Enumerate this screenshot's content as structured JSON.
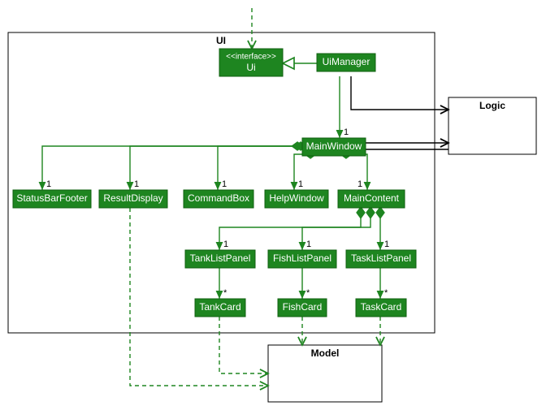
{
  "packages": {
    "ui": {
      "label": "UI"
    },
    "logic": {
      "label": "Logic"
    },
    "model": {
      "label": "Model"
    }
  },
  "nodes": {
    "ui_if": {
      "stereo": "<<interface>>",
      "name": "Ui"
    },
    "uimanager": {
      "name": "UiManager"
    },
    "mainwindow": {
      "name": "MainWindow"
    },
    "statusbar": {
      "name": "StatusBarFooter"
    },
    "resultdisp": {
      "name": "ResultDisplay"
    },
    "commandbox": {
      "name": "CommandBox"
    },
    "helpwindow": {
      "name": "HelpWindow"
    },
    "maincontent": {
      "name": "MainContent"
    },
    "tanklist": {
      "name": "TankListPanel"
    },
    "fishlist": {
      "name": "FishListPanel"
    },
    "tasklist": {
      "name": "TaskListPanel"
    },
    "tankcard": {
      "name": "TankCard"
    },
    "fishcard": {
      "name": "FishCard"
    },
    "taskcard": {
      "name": "TaskCard"
    }
  },
  "mult": {
    "one": "1",
    "star": "*"
  },
  "chart_data": {
    "type": "uml-class-diagram",
    "packages": [
      {
        "name": "UI",
        "contains": [
          "Ui",
          "UiManager",
          "MainWindow",
          "StatusBarFooter",
          "ResultDisplay",
          "CommandBox",
          "HelpWindow",
          "MainContent",
          "TankListPanel",
          "FishListPanel",
          "TaskListPanel",
          "TankCard",
          "FishCard",
          "TaskCard"
        ]
      },
      {
        "name": "Logic",
        "contains": []
      },
      {
        "name": "Model",
        "contains": []
      }
    ],
    "interfaces": [
      "Ui"
    ],
    "relationships": [
      {
        "from": "external",
        "to": "Ui",
        "kind": "dependency"
      },
      {
        "from": "UiManager",
        "to": "Ui",
        "kind": "realization"
      },
      {
        "from": "UiManager",
        "to": "MainWindow",
        "kind": "association",
        "mult_to": "1"
      },
      {
        "from": "MainWindow",
        "to": "StatusBarFooter",
        "kind": "composition",
        "mult_to": "1"
      },
      {
        "from": "MainWindow",
        "to": "ResultDisplay",
        "kind": "composition",
        "mult_to": "1"
      },
      {
        "from": "MainWindow",
        "to": "CommandBox",
        "kind": "composition",
        "mult_to": "1"
      },
      {
        "from": "MainWindow",
        "to": "HelpWindow",
        "kind": "composition",
        "mult_to": "1"
      },
      {
        "from": "MainWindow",
        "to": "MainContent",
        "kind": "composition",
        "mult_to": "1"
      },
      {
        "from": "MainContent",
        "to": "TankListPanel",
        "kind": "composition",
        "mult_to": "1"
      },
      {
        "from": "MainContent",
        "to": "FishListPanel",
        "kind": "composition",
        "mult_to": "1"
      },
      {
        "from": "MainContent",
        "to": "TaskListPanel",
        "kind": "composition",
        "mult_to": "1"
      },
      {
        "from": "TankListPanel",
        "to": "TankCard",
        "kind": "association",
        "mult_to": "*"
      },
      {
        "from": "FishListPanel",
        "to": "FishCard",
        "kind": "association",
        "mult_to": "*"
      },
      {
        "from": "TaskListPanel",
        "to": "TaskCard",
        "kind": "association",
        "mult_to": "*"
      },
      {
        "from": "UiManager",
        "to": "Logic",
        "kind": "association"
      },
      {
        "from": "MainWindow",
        "to": "Logic",
        "kind": "association"
      },
      {
        "from": "TankCard",
        "to": "Model",
        "kind": "dependency"
      },
      {
        "from": "FishCard",
        "to": "Model",
        "kind": "dependency"
      },
      {
        "from": "TaskCard",
        "to": "Model",
        "kind": "dependency"
      },
      {
        "from": "ResultDisplay",
        "to": "Model",
        "kind": "dependency"
      }
    ]
  }
}
